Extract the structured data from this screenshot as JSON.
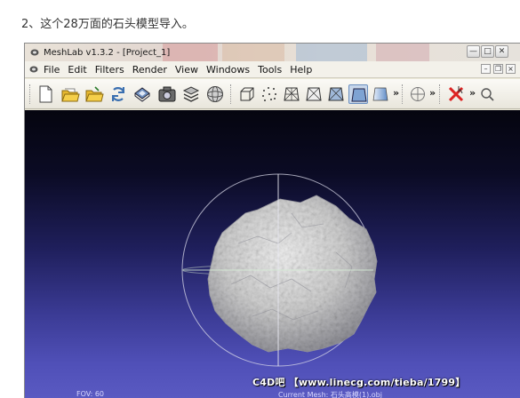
{
  "caption": "2、这个28万面的石头模型导入。",
  "window": {
    "title": "MeshLab v1.3.2 - [Project_1]",
    "buttons": {
      "minimize": "—",
      "maximize": "□",
      "close": "✕"
    }
  },
  "menubar": {
    "items": [
      "File",
      "Edit",
      "Filters",
      "Render",
      "View",
      "Windows",
      "Tools",
      "Help"
    ],
    "mdi_buttons": {
      "minimize": "–",
      "restore": "❐",
      "close": "×"
    }
  },
  "toolbar": {
    "overflow_1": "»",
    "overflow_2": "»",
    "overflow_3": "»",
    "active_tool": "render-flat-lines"
  },
  "viewport": {
    "watermark": "C4D吧 【www.linecg.com/tieba/1799】",
    "fov_label": "FOV: 60",
    "current_mesh_label": "Current Mesh: 石头高模(1).obj",
    "colors": {
      "background_top": "#05050f",
      "background_bottom": "#5a5ac2",
      "mesh": "#c8c8c8",
      "trackball": "#d8d8e8"
    }
  }
}
